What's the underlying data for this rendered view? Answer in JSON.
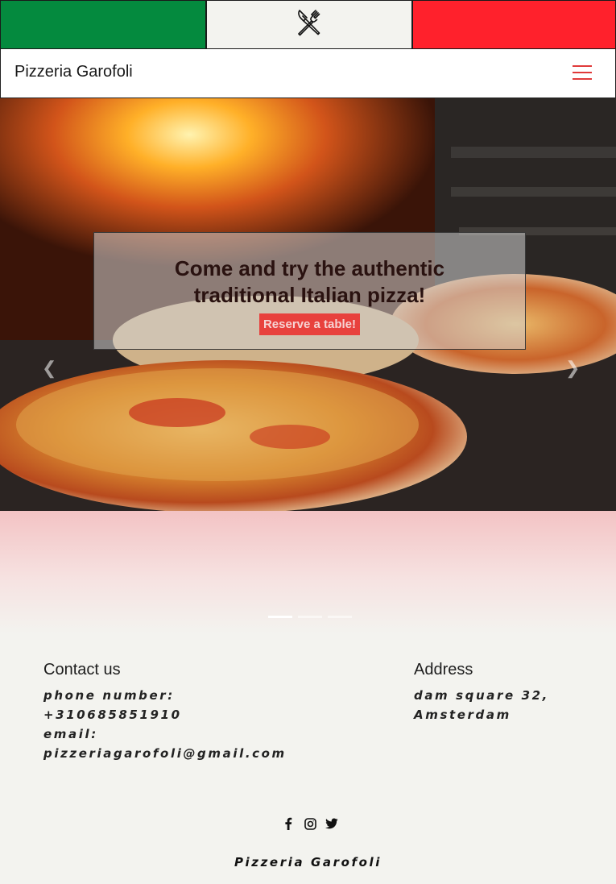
{
  "flag": {
    "colors": [
      "#048a3e",
      "#f3f3ef",
      "#ff212c"
    ],
    "icon": "fork-knife-icon"
  },
  "navbar": {
    "brand": "Pizzeria Garofoli",
    "menu_icon": "hamburger-menu-icon",
    "menu_color": "#e03a3a"
  },
  "hero": {
    "headline_line1": "Come and try the authentic",
    "headline_line2": "traditional Italian pizza!",
    "cta_label": "Reserve a table!",
    "prev_icon": "chevron-left-icon",
    "next_icon": "chevron-right-icon",
    "slide_count": 3,
    "active_slide": 1
  },
  "contact": {
    "title": "Contact us",
    "phone_label": "phone number:",
    "phone": "+310685851910",
    "email_label": "email:",
    "email": "pizzeriagarofoli@gmail.com"
  },
  "address": {
    "title": "Address",
    "line1": "dam square 32,",
    "line2": "Amsterdam"
  },
  "socials": [
    "facebook-icon",
    "instagram-icon",
    "twitter-icon"
  ],
  "footer": {
    "name": "Pizzeria Garofoli"
  }
}
